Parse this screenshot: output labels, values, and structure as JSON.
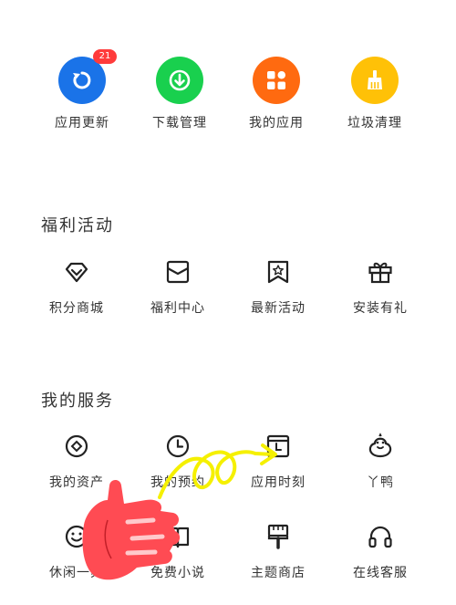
{
  "colors": {
    "blue": "#1a73e8",
    "green": "#19d04e",
    "orange": "#ff6a10",
    "yellow": "#ffc107",
    "badge_red": "#ff3b3b",
    "line_icon": "#222222",
    "hand": "#ff4b53",
    "scribble": "#f5f000"
  },
  "top_grid": [
    {
      "label": "应用更新",
      "icon": "refresh-icon",
      "color": "blue",
      "badge": "21"
    },
    {
      "label": "下载管理",
      "icon": "download-icon",
      "color": "green"
    },
    {
      "label": "我的应用",
      "icon": "apps-grid-icon",
      "color": "orange"
    },
    {
      "label": "垃圾清理",
      "icon": "broom-icon",
      "color": "yellow"
    }
  ],
  "welfare": {
    "title": "福利活动",
    "items": [
      {
        "label": "积分商城",
        "icon": "diamond-icon"
      },
      {
        "label": "福利中心",
        "icon": "envelope-icon"
      },
      {
        "label": "最新活动",
        "icon": "bookmark-star-icon"
      },
      {
        "label": "安装有礼",
        "icon": "gift-icon"
      }
    ]
  },
  "services": {
    "title": "我的服务",
    "row1": [
      {
        "label": "我的资产",
        "icon": "coin-icon"
      },
      {
        "label": "我的预约",
        "icon": "clock-icon"
      },
      {
        "label": "应用时刻",
        "icon": "calendar-icon"
      },
      {
        "label": "丫鸭",
        "icon": "duck-icon"
      }
    ],
    "row2": [
      {
        "label": "休闲一刻",
        "icon": "smiley-icon"
      },
      {
        "label": "免费小说",
        "icon": "book-icon"
      },
      {
        "label": "主题商店",
        "icon": "paint-brush-icon"
      },
      {
        "label": "在线客服",
        "icon": "headset-icon"
      }
    ]
  }
}
